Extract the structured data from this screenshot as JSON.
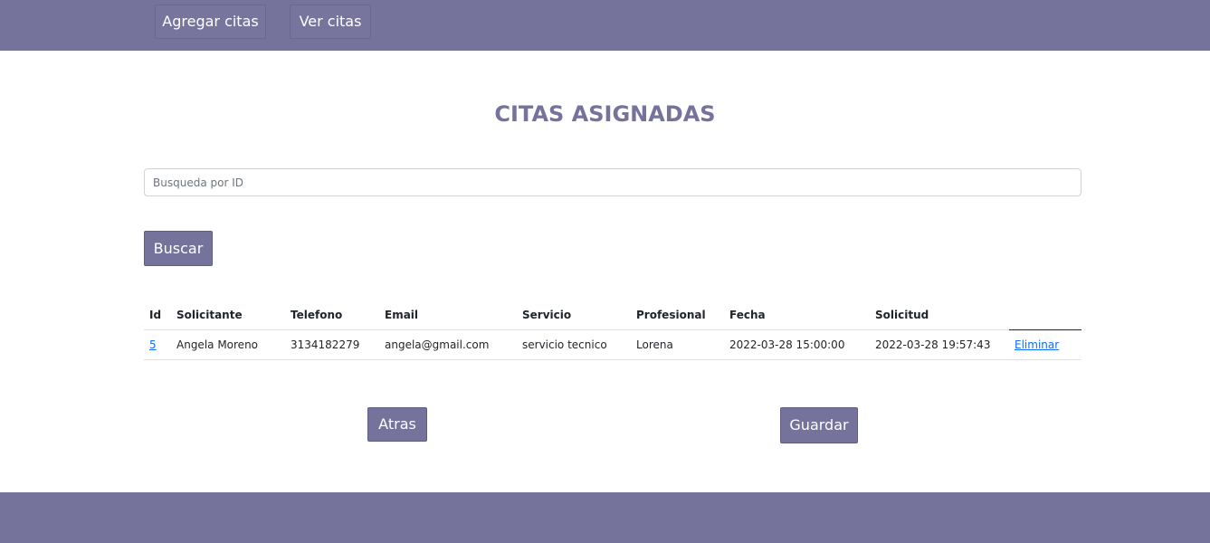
{
  "nav": {
    "add_label": "Agregar citas",
    "view_label": "Ver citas"
  },
  "page": {
    "title": "CITAS ASIGNADAS"
  },
  "search": {
    "placeholder": "Busqueda por ID",
    "value": "",
    "button_label": "Buscar"
  },
  "table": {
    "headers": {
      "id": "Id",
      "solicitante": "Solicitante",
      "telefono": "Telefono",
      "email": "Email",
      "servicio": "Servicio",
      "profesional": "Profesional",
      "fecha": "Fecha",
      "solicitud": "Solicitud"
    },
    "rows": [
      {
        "id": "5",
        "solicitante": "Angela Moreno",
        "telefono": "3134182279",
        "email": "angela@gmail.com",
        "servicio": "servicio tecnico",
        "profesional": "Lorena",
        "fecha": "2022-03-28 15:00:00",
        "solicitud": "2022-03-28 19:57:43",
        "action_label": "Eliminar"
      }
    ]
  },
  "actions": {
    "back_label": "Atras",
    "save_label": "Guardar"
  },
  "colors": {
    "brand": "#75729c",
    "link": "#0d6efd"
  }
}
